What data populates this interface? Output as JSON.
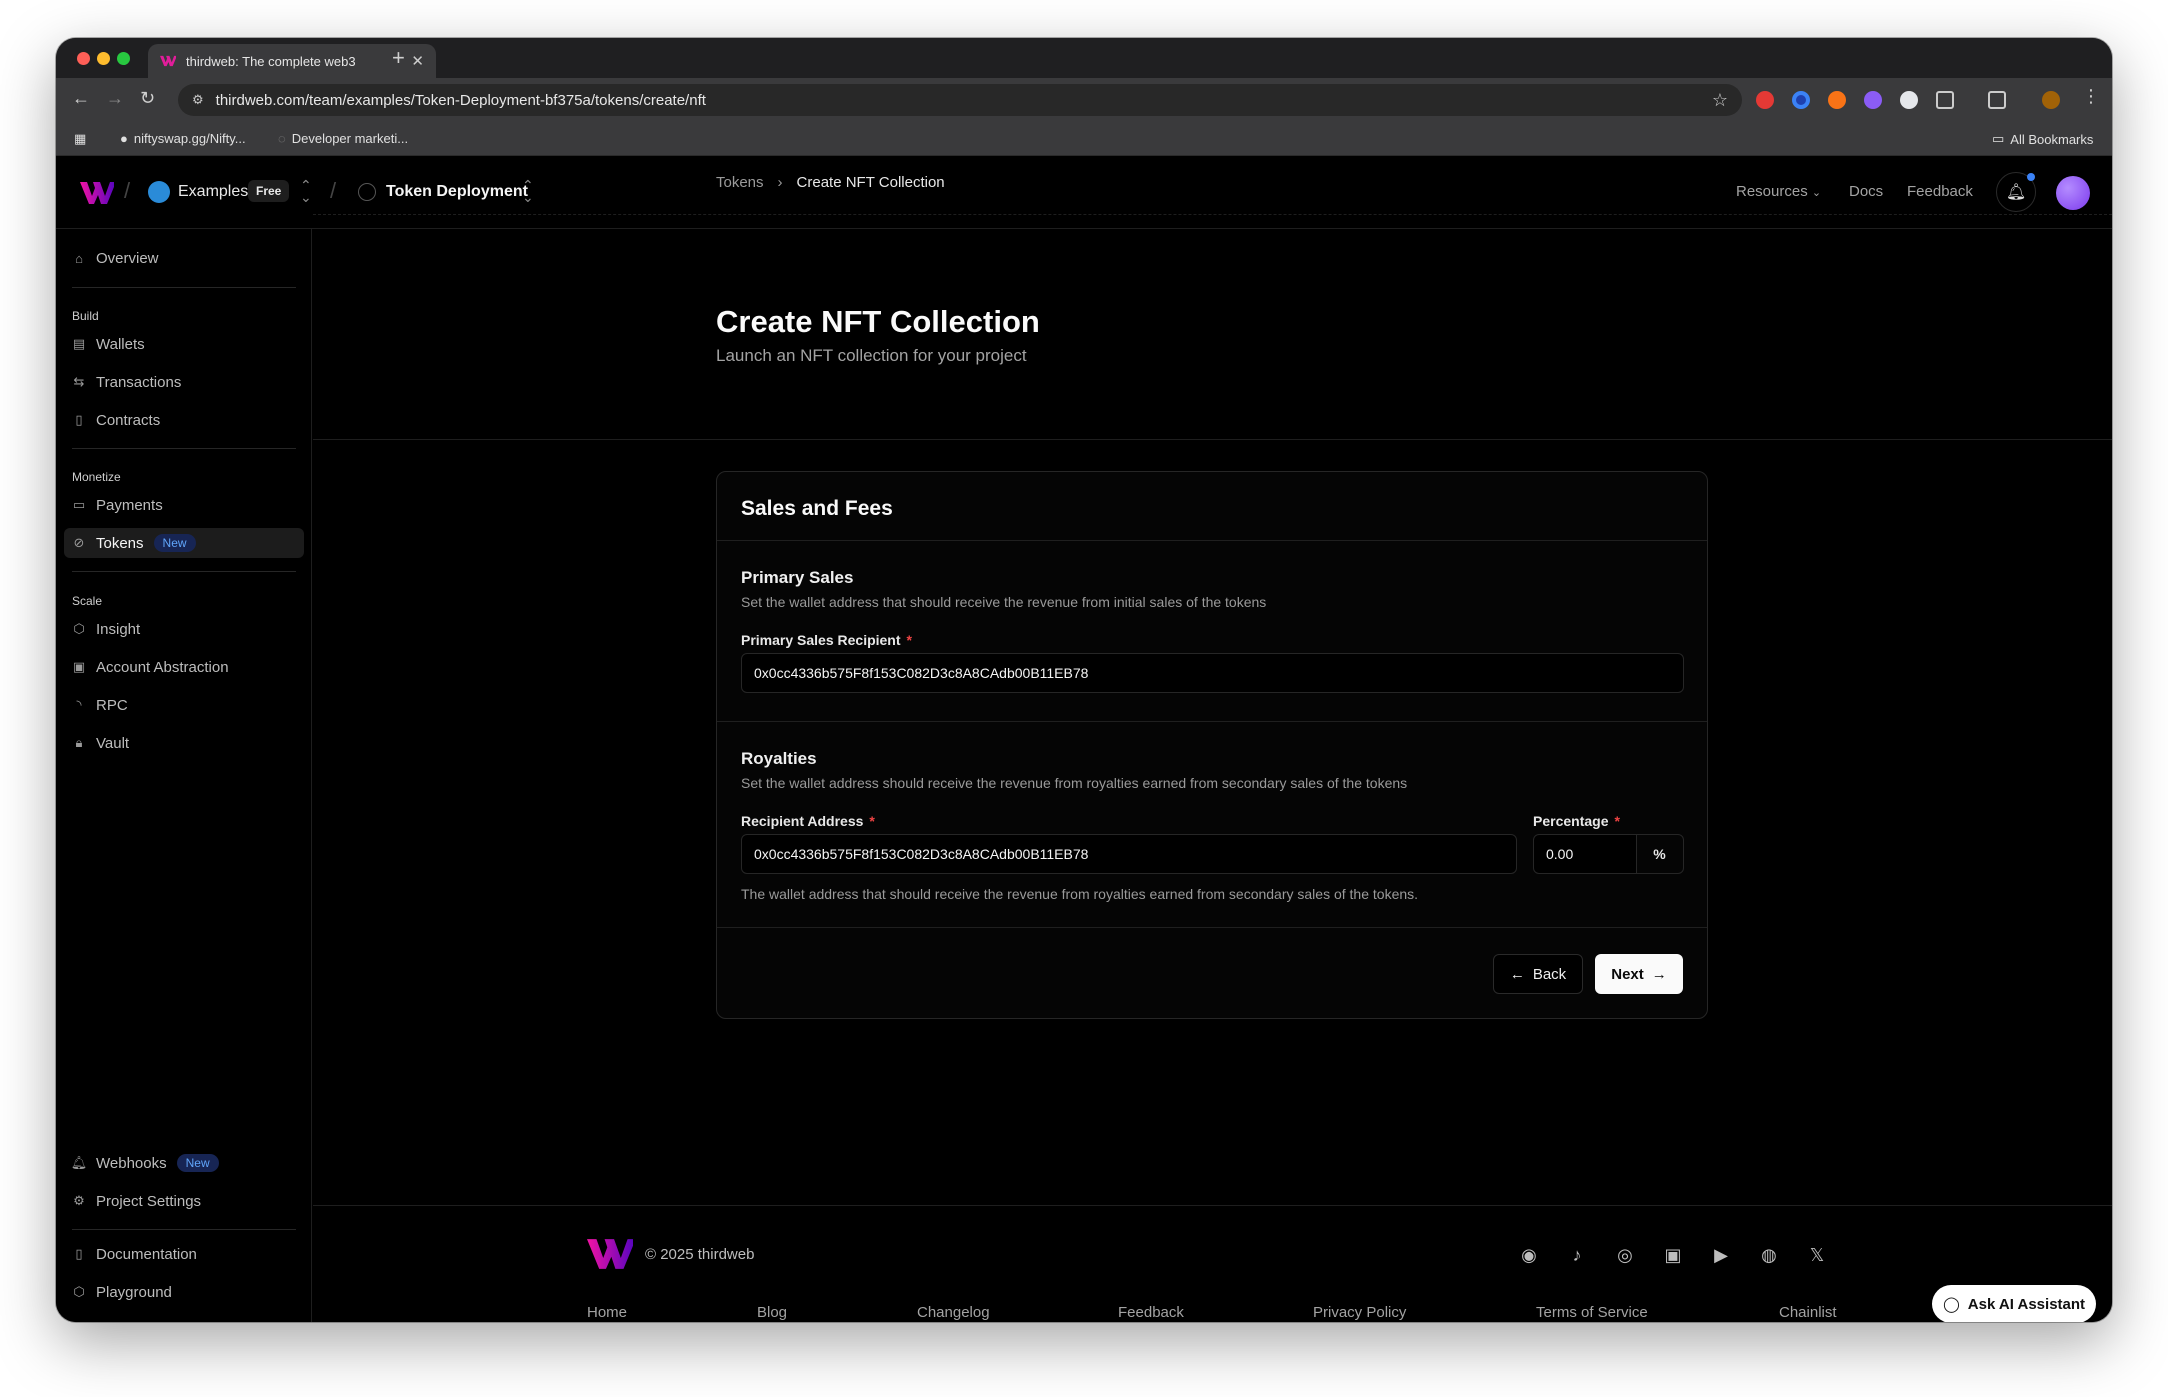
{
  "browser": {
    "tab_title": "thirdweb: The complete web3",
    "url": "thirdweb.com/team/examples/Token-Deployment-bf375a/tokens/create/nft",
    "bookmarks": [
      "niftyswap.gg/Nifty...",
      "Developer marketi..."
    ],
    "all_bookmarks": "All Bookmarks"
  },
  "topnav": {
    "team": "Examples",
    "plan": "Free",
    "project": "Token Deployment",
    "links": [
      "Resources",
      "Docs",
      "Feedback"
    ]
  },
  "sidebar": {
    "overview": "Overview",
    "sections": {
      "build": "Build",
      "monetize": "Monetize",
      "scale": "Scale"
    },
    "build_items": [
      "Wallets",
      "Transactions",
      "Contracts"
    ],
    "monetize_items": [
      "Payments",
      "Tokens"
    ],
    "scale_items": [
      "Insight",
      "Account Abstraction",
      "RPC",
      "Vault"
    ],
    "new_badge": "New",
    "bottom_items": [
      "Webhooks",
      "Project Settings",
      "Documentation",
      "Playground"
    ]
  },
  "breadcrumb": {
    "parent": "Tokens",
    "current": "Create NFT Collection"
  },
  "page": {
    "title": "Create NFT Collection",
    "subtitle": "Launch an NFT collection for your project"
  },
  "card": {
    "title": "Sales and Fees",
    "primary": {
      "title": "Primary Sales",
      "description": "Set the wallet address that should receive the revenue from initial sales of the tokens",
      "recipient_label": "Primary Sales Recipient",
      "recipient_value": "0x0cc4336b575F8f153C082D3c8A8CAdb00B11EB78"
    },
    "royalties": {
      "title": "Royalties",
      "description": "Set the wallet address should receive the revenue from royalties earned from secondary sales of the tokens",
      "address_label": "Recipient Address",
      "address_value": "0x0cc4336b575F8f153C082D3c8A8CAdb00B11EB78",
      "percentage_label": "Percentage",
      "percentage_value": "0.00",
      "percent_symbol": "%",
      "hint": "The wallet address that should receive the revenue from royalties earned from secondary sales of the tokens."
    },
    "back_label": "Back",
    "next_label": "Next"
  },
  "footer": {
    "copyright": "© 2025 thirdweb",
    "links": [
      "Home",
      "Blog",
      "Changelog",
      "Feedback",
      "Privacy Policy",
      "Terms of Service",
      "Chainlist"
    ],
    "social_icons": [
      "github-icon",
      "tiktok-icon",
      "instagram-icon",
      "linkedin-icon",
      "youtube-icon",
      "reddit-icon",
      "x-icon"
    ],
    "ai_button": "Ask AI Assistant"
  },
  "colors": {
    "accent_pink": "#e11d9a",
    "accent_purple": "#7c3aed",
    "required": "#ef4444",
    "new_badge": "#60a5fa"
  }
}
